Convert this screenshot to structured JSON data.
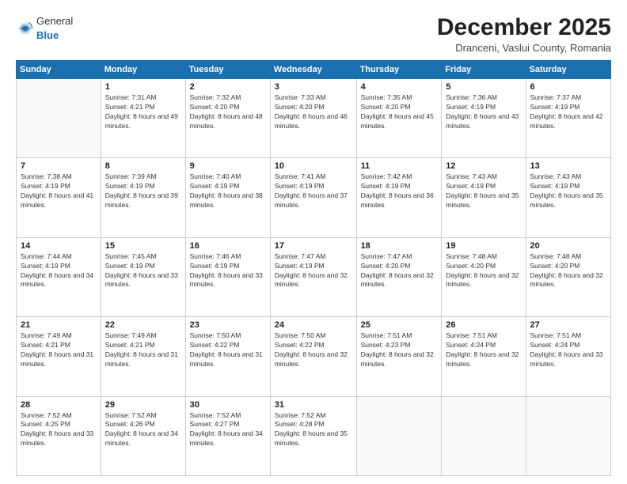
{
  "logo": {
    "general": "General",
    "blue": "Blue"
  },
  "title": "December 2025",
  "location": "Dranceni, Vaslui County, Romania",
  "days_header": [
    "Sunday",
    "Monday",
    "Tuesday",
    "Wednesday",
    "Thursday",
    "Friday",
    "Saturday"
  ],
  "weeks": [
    [
      {
        "day": "",
        "sunrise": "",
        "sunset": "",
        "daylight": ""
      },
      {
        "day": "1",
        "sunrise": "Sunrise: 7:31 AM",
        "sunset": "Sunset: 4:21 PM",
        "daylight": "Daylight: 8 hours and 49 minutes."
      },
      {
        "day": "2",
        "sunrise": "Sunrise: 7:32 AM",
        "sunset": "Sunset: 4:20 PM",
        "daylight": "Daylight: 8 hours and 48 minutes."
      },
      {
        "day": "3",
        "sunrise": "Sunrise: 7:33 AM",
        "sunset": "Sunset: 4:20 PM",
        "daylight": "Daylight: 8 hours and 46 minutes."
      },
      {
        "day": "4",
        "sunrise": "Sunrise: 7:35 AM",
        "sunset": "Sunset: 4:20 PM",
        "daylight": "Daylight: 8 hours and 45 minutes."
      },
      {
        "day": "5",
        "sunrise": "Sunrise: 7:36 AM",
        "sunset": "Sunset: 4:19 PM",
        "daylight": "Daylight: 8 hours and 43 minutes."
      },
      {
        "day": "6",
        "sunrise": "Sunrise: 7:37 AM",
        "sunset": "Sunset: 4:19 PM",
        "daylight": "Daylight: 8 hours and 42 minutes."
      }
    ],
    [
      {
        "day": "7",
        "sunrise": "Sunrise: 7:38 AM",
        "sunset": "Sunset: 4:19 PM",
        "daylight": "Daylight: 8 hours and 41 minutes."
      },
      {
        "day": "8",
        "sunrise": "Sunrise: 7:39 AM",
        "sunset": "Sunset: 4:19 PM",
        "daylight": "Daylight: 8 hours and 39 minutes."
      },
      {
        "day": "9",
        "sunrise": "Sunrise: 7:40 AM",
        "sunset": "Sunset: 4:19 PM",
        "daylight": "Daylight: 8 hours and 38 minutes."
      },
      {
        "day": "10",
        "sunrise": "Sunrise: 7:41 AM",
        "sunset": "Sunset: 4:19 PM",
        "daylight": "Daylight: 8 hours and 37 minutes."
      },
      {
        "day": "11",
        "sunrise": "Sunrise: 7:42 AM",
        "sunset": "Sunset: 4:19 PM",
        "daylight": "Daylight: 8 hours and 36 minutes."
      },
      {
        "day": "12",
        "sunrise": "Sunrise: 7:43 AM",
        "sunset": "Sunset: 4:19 PM",
        "daylight": "Daylight: 8 hours and 35 minutes."
      },
      {
        "day": "13",
        "sunrise": "Sunrise: 7:43 AM",
        "sunset": "Sunset: 4:19 PM",
        "daylight": "Daylight: 8 hours and 35 minutes."
      }
    ],
    [
      {
        "day": "14",
        "sunrise": "Sunrise: 7:44 AM",
        "sunset": "Sunset: 4:19 PM",
        "daylight": "Daylight: 8 hours and 34 minutes."
      },
      {
        "day": "15",
        "sunrise": "Sunrise: 7:45 AM",
        "sunset": "Sunset: 4:19 PM",
        "daylight": "Daylight: 8 hours and 33 minutes."
      },
      {
        "day": "16",
        "sunrise": "Sunrise: 7:46 AM",
        "sunset": "Sunset: 4:19 PM",
        "daylight": "Daylight: 8 hours and 33 minutes."
      },
      {
        "day": "17",
        "sunrise": "Sunrise: 7:47 AM",
        "sunset": "Sunset: 4:19 PM",
        "daylight": "Daylight: 8 hours and 32 minutes."
      },
      {
        "day": "18",
        "sunrise": "Sunrise: 7:47 AM",
        "sunset": "Sunset: 4:20 PM",
        "daylight": "Daylight: 8 hours and 32 minutes."
      },
      {
        "day": "19",
        "sunrise": "Sunrise: 7:48 AM",
        "sunset": "Sunset: 4:20 PM",
        "daylight": "Daylight: 8 hours and 32 minutes."
      },
      {
        "day": "20",
        "sunrise": "Sunrise: 7:48 AM",
        "sunset": "Sunset: 4:20 PM",
        "daylight": "Daylight: 8 hours and 32 minutes."
      }
    ],
    [
      {
        "day": "21",
        "sunrise": "Sunrise: 7:49 AM",
        "sunset": "Sunset: 4:21 PM",
        "daylight": "Daylight: 8 hours and 31 minutes."
      },
      {
        "day": "22",
        "sunrise": "Sunrise: 7:49 AM",
        "sunset": "Sunset: 4:21 PM",
        "daylight": "Daylight: 8 hours and 31 minutes."
      },
      {
        "day": "23",
        "sunrise": "Sunrise: 7:50 AM",
        "sunset": "Sunset: 4:22 PM",
        "daylight": "Daylight: 8 hours and 31 minutes."
      },
      {
        "day": "24",
        "sunrise": "Sunrise: 7:50 AM",
        "sunset": "Sunset: 4:22 PM",
        "daylight": "Daylight: 8 hours and 32 minutes."
      },
      {
        "day": "25",
        "sunrise": "Sunrise: 7:51 AM",
        "sunset": "Sunset: 4:23 PM",
        "daylight": "Daylight: 8 hours and 32 minutes."
      },
      {
        "day": "26",
        "sunrise": "Sunrise: 7:51 AM",
        "sunset": "Sunset: 4:24 PM",
        "daylight": "Daylight: 8 hours and 32 minutes."
      },
      {
        "day": "27",
        "sunrise": "Sunrise: 7:51 AM",
        "sunset": "Sunset: 4:24 PM",
        "daylight": "Daylight: 8 hours and 33 minutes."
      }
    ],
    [
      {
        "day": "28",
        "sunrise": "Sunrise: 7:52 AM",
        "sunset": "Sunset: 4:25 PM",
        "daylight": "Daylight: 8 hours and 33 minutes."
      },
      {
        "day": "29",
        "sunrise": "Sunrise: 7:52 AM",
        "sunset": "Sunset: 4:26 PM",
        "daylight": "Daylight: 8 hours and 34 minutes."
      },
      {
        "day": "30",
        "sunrise": "Sunrise: 7:52 AM",
        "sunset": "Sunset: 4:27 PM",
        "daylight": "Daylight: 8 hours and 34 minutes."
      },
      {
        "day": "31",
        "sunrise": "Sunrise: 7:52 AM",
        "sunset": "Sunset: 4:28 PM",
        "daylight": "Daylight: 8 hours and 35 minutes."
      },
      {
        "day": "",
        "sunrise": "",
        "sunset": "",
        "daylight": ""
      },
      {
        "day": "",
        "sunrise": "",
        "sunset": "",
        "daylight": ""
      },
      {
        "day": "",
        "sunrise": "",
        "sunset": "",
        "daylight": ""
      }
    ]
  ]
}
